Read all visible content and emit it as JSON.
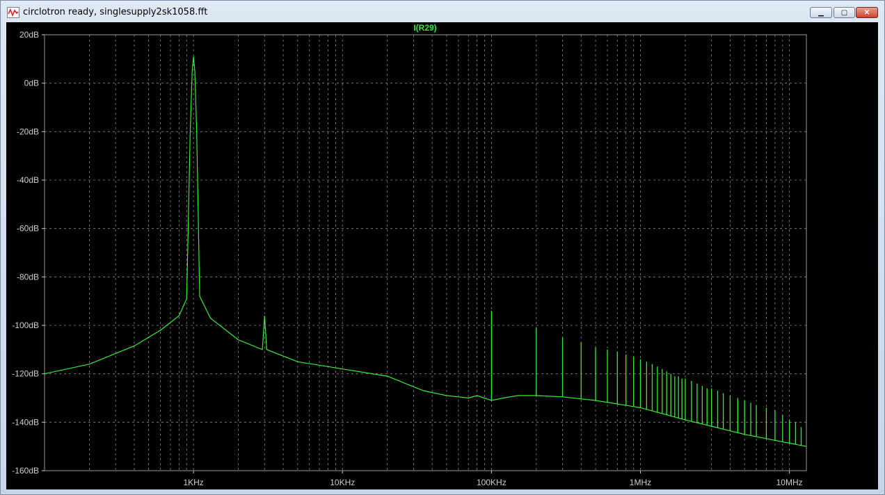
{
  "window": {
    "title": "circlotron ready, singlesupply2sk1058.fft",
    "buttons": {
      "minimize": "▁",
      "maximize": "▢",
      "close": "✕"
    }
  },
  "colors": {
    "background": "#000000",
    "trace": "#33ee33",
    "grid": "#8a8a8a",
    "axis_text": "#cfcfcf",
    "title_text": "#33ee33"
  },
  "chart_data": {
    "type": "line",
    "title": "I(R29)",
    "xscale": "log",
    "xlim": [
      100,
      13000000
    ],
    "ylim": [
      -160,
      20
    ],
    "yticks": [
      {
        "value": 20,
        "label": "20dB"
      },
      {
        "value": 0,
        "label": "0dB"
      },
      {
        "value": -20,
        "label": "-20dB"
      },
      {
        "value": -40,
        "label": "-40dB"
      },
      {
        "value": -60,
        "label": "-60dB"
      },
      {
        "value": -80,
        "label": "-80dB"
      },
      {
        "value": -100,
        "label": "-100dB"
      },
      {
        "value": -120,
        "label": "-120dB"
      },
      {
        "value": -140,
        "label": "-140dB"
      },
      {
        "value": -160,
        "label": "-160dB"
      }
    ],
    "xticks": [
      {
        "value": 1000,
        "label": "1KHz"
      },
      {
        "value": 10000,
        "label": "10KHz"
      },
      {
        "value": 100000,
        "label": "100KHz"
      },
      {
        "value": 1000000,
        "label": "1MHz"
      },
      {
        "value": 10000000,
        "label": "10MHz"
      }
    ],
    "grid": true,
    "series": [
      {
        "name": "I(R29)",
        "x": [
          100,
          200,
          400,
          600,
          800,
          900,
          950,
          980,
          1000,
          1020,
          1050,
          1100,
          1300,
          2000,
          2900,
          3000,
          3100,
          5000,
          10000,
          20000,
          35000,
          50000,
          60000,
          70000,
          80000,
          100000,
          120000,
          150000,
          200000,
          300000,
          500000,
          1000000,
          2000000,
          5000000,
          13000000
        ],
        "values": [
          -120,
          -116,
          -108.5,
          -102,
          -96,
          -89,
          -20,
          5,
          11,
          5,
          -20,
          -88,
          -97,
          -106,
          -110,
          -96,
          -110,
          -115,
          -118,
          -121,
          -127,
          -129,
          -129.5,
          -130,
          -129,
          -131,
          -130,
          -129,
          -129,
          -129.5,
          -131,
          -134,
          -139,
          -145,
          -150
        ]
      }
    ],
    "spikes": [
      {
        "x": 100000,
        "value": -94
      },
      {
        "x": 200000,
        "value": -101
      },
      {
        "x": 300000,
        "value": -105
      },
      {
        "x": 400000,
        "value": -107
      },
      {
        "x": 500000,
        "value": -109
      },
      {
        "x": 600000,
        "value": -110
      },
      {
        "x": 700000,
        "value": -111
      },
      {
        "x": 800000,
        "value": -112
      },
      {
        "x": 900000,
        "value": -113
      },
      {
        "x": 1000000,
        "value": -114
      },
      {
        "x": 1100000,
        "value": -115
      },
      {
        "x": 1200000,
        "value": -116
      },
      {
        "x": 1300000,
        "value": -117
      },
      {
        "x": 1400000,
        "value": -118
      },
      {
        "x": 1500000,
        "value": -119
      },
      {
        "x": 1600000,
        "value": -120
      },
      {
        "x": 1700000,
        "value": -121
      },
      {
        "x": 1800000,
        "value": -121
      },
      {
        "x": 1900000,
        "value": -122
      },
      {
        "x": 2000000,
        "value": -122
      },
      {
        "x": 2200000,
        "value": -123
      },
      {
        "x": 2400000,
        "value": -124
      },
      {
        "x": 2600000,
        "value": -125
      },
      {
        "x": 2800000,
        "value": -126
      },
      {
        "x": 3000000,
        "value": -126
      },
      {
        "x": 3300000,
        "value": -127
      },
      {
        "x": 3600000,
        "value": -128
      },
      {
        "x": 4000000,
        "value": -129
      },
      {
        "x": 4500000,
        "value": -130
      },
      {
        "x": 5000000,
        "value": -131
      },
      {
        "x": 5500000,
        "value": -132
      },
      {
        "x": 6000000,
        "value": -133
      },
      {
        "x": 7000000,
        "value": -134
      },
      {
        "x": 8000000,
        "value": -135
      },
      {
        "x": 9000000,
        "value": -137
      },
      {
        "x": 10000000,
        "value": -139
      },
      {
        "x": 11000000,
        "value": -140
      },
      {
        "x": 12000000,
        "value": -142
      }
    ]
  }
}
